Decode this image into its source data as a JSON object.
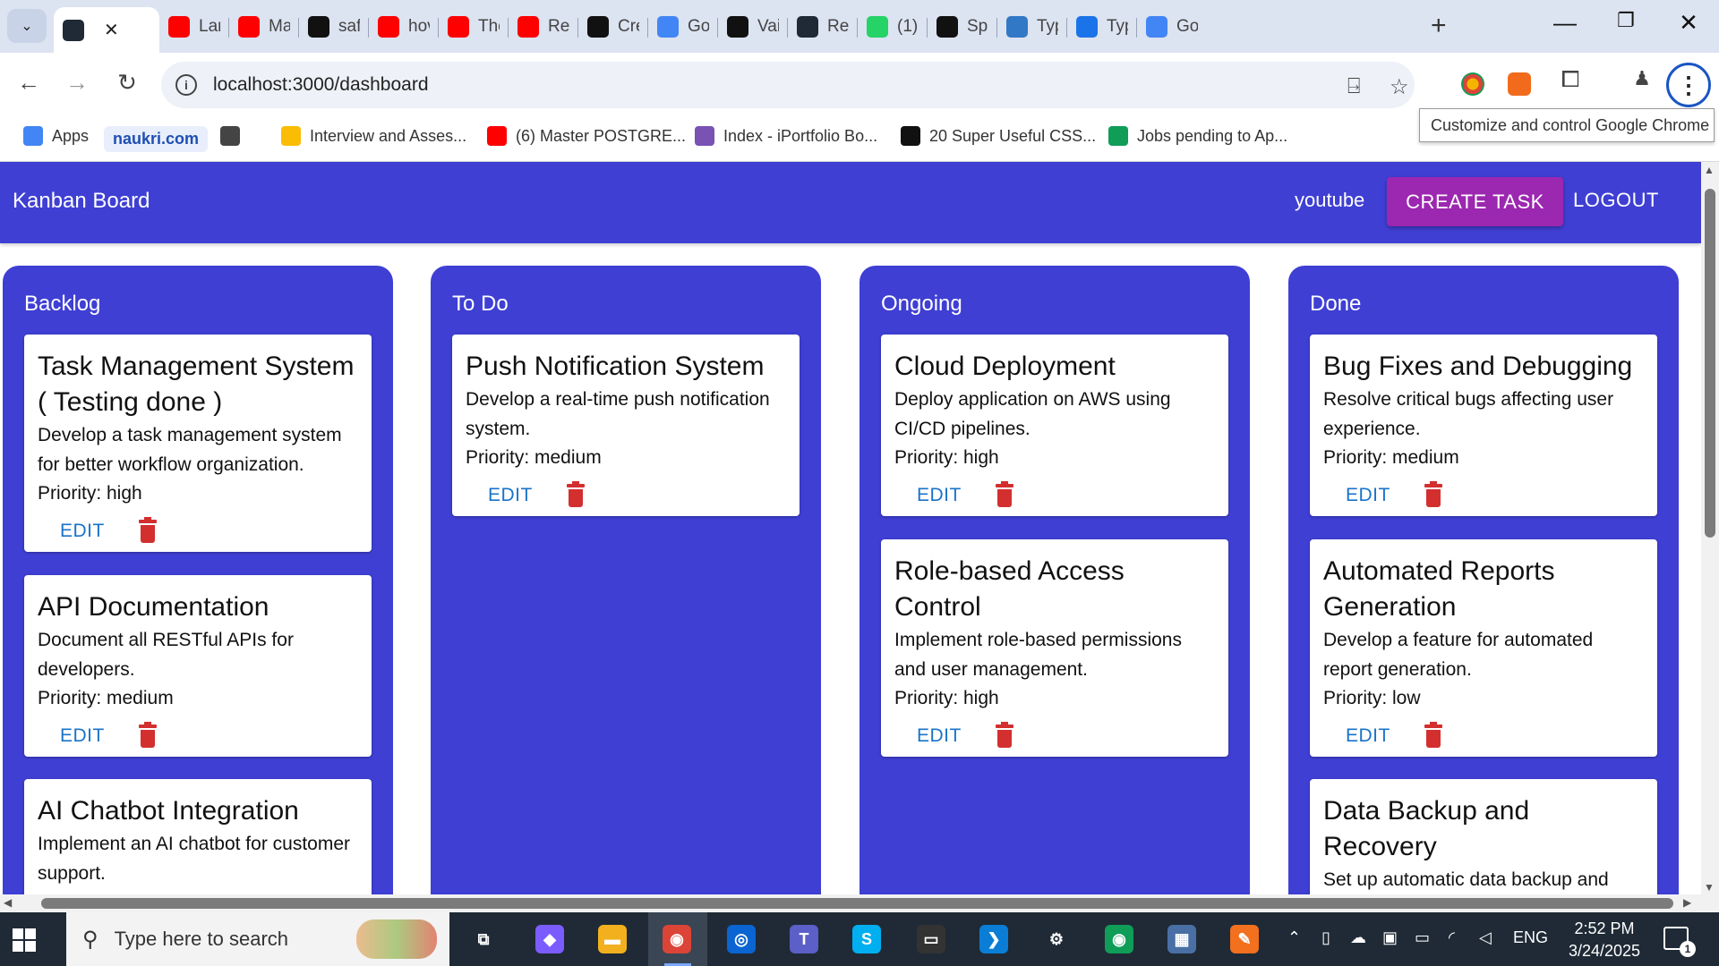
{
  "browser": {
    "tabs": [
      {
        "label": "",
        "icon": "react-icon",
        "color": "#1f2a36",
        "active": true
      },
      {
        "label": "Lar",
        "icon": "youtube-icon",
        "color": "#ff0000"
      },
      {
        "label": "Ma",
        "icon": "youtube-icon",
        "color": "#ff0000"
      },
      {
        "label": "safe",
        "icon": "github-icon",
        "color": "#111111"
      },
      {
        "label": "hov",
        "icon": "youtube-icon",
        "color": "#ff0000"
      },
      {
        "label": "The",
        "icon": "youtube-icon",
        "color": "#ff0000"
      },
      {
        "label": "Rea",
        "icon": "youtube-icon",
        "color": "#ff0000"
      },
      {
        "label": "Cre",
        "icon": "openai-icon",
        "color": "#111111"
      },
      {
        "label": "Goo",
        "icon": "google-icon",
        "color": "#4285f4"
      },
      {
        "label": "Vai",
        "icon": "github-icon",
        "color": "#111111"
      },
      {
        "label": "Rea",
        "icon": "react-icon",
        "color": "#1f2a36"
      },
      {
        "label": "(1)",
        "icon": "whatsapp-icon",
        "color": "#25d366"
      },
      {
        "label": "Spe",
        "icon": "medium-icon",
        "color": "#111111"
      },
      {
        "label": "Typ",
        "icon": "typescript-icon",
        "color": "#3178c6"
      },
      {
        "label": "Typ",
        "icon": "bolt-icon",
        "color": "#1a73e8"
      },
      {
        "label": "Goo",
        "icon": "google-keys-icon",
        "color": "#4285f4"
      }
    ],
    "url": "localhost:3000/dashboard",
    "tooltip": "Customize and control Google Chrome",
    "bookmarks": [
      {
        "label": "Apps",
        "icon": "apps-grid-icon",
        "color": "#4285f4"
      },
      {
        "label": "naukri.com",
        "icon": "",
        "color": "#1e4fb3",
        "pill": true
      },
      {
        "label": "",
        "icon": "grid-icon",
        "color": "#444444"
      },
      {
        "label": "Interview and Asses...",
        "icon": "google-drive-icon",
        "color": "#fbbc04"
      },
      {
        "label": "(6) Master POSTGRE...",
        "icon": "youtube-icon",
        "color": "#ff0000"
      },
      {
        "label": "Index - iPortfolio Bo...",
        "icon": "bootstrap-icon",
        "color": "#7952b3"
      },
      {
        "label": "20 Super Useful CSS...",
        "icon": "dev-icon",
        "color": "#111111"
      },
      {
        "label": "Jobs pending to Ap...",
        "icon": "sheets-icon",
        "color": "#0f9d58"
      }
    ]
  },
  "app": {
    "title": "Kanban Board",
    "user": "youtube",
    "create_label": "CREATE TASK",
    "logout_label": "LOGOUT",
    "accent": "#3f3fd4",
    "create_color": "#9c27b0",
    "edit_label": "EDIT",
    "columns": [
      {
        "title": "Backlog",
        "cards": [
          {
            "title": "Task Management System ( Testing done )",
            "description": "Develop a task management system for better workflow organization.",
            "priority": "Priority: high"
          },
          {
            "title": "API Documentation",
            "description": "Document all RESTful APIs for developers.",
            "priority": "Priority: medium"
          },
          {
            "title": "AI Chatbot Integration",
            "description": "Implement an AI chatbot for customer support.",
            "priority": ""
          }
        ]
      },
      {
        "title": "To Do",
        "cards": [
          {
            "title": "Push Notification System",
            "description": "Develop a real-time push notification system.",
            "priority": "Priority: medium"
          }
        ]
      },
      {
        "title": "Ongoing",
        "cards": [
          {
            "title": "Cloud Deployment",
            "description": "Deploy application on AWS using CI/CD pipelines.",
            "priority": "Priority: high"
          },
          {
            "title": "Role-based Access Control",
            "description": "Implement role-based permissions and user management.",
            "priority": "Priority: high"
          }
        ]
      },
      {
        "title": "Done",
        "cards": [
          {
            "title": "Bug Fixes and Debugging",
            "description": "Resolve critical bugs affecting user experience.",
            "priority": "Priority: medium"
          },
          {
            "title": "Automated Reports Generation",
            "description": "Develop a feature for automated report generation.",
            "priority": "Priority: low"
          },
          {
            "title": "Data Backup and Recovery",
            "description": "Set up automatic data backup and",
            "priority": ""
          }
        ]
      }
    ]
  },
  "taskbar": {
    "search_placeholder": "Type here to search",
    "apps": [
      {
        "name": "task-view-icon",
        "color": "#1f2a36",
        "glyph": "⧉"
      },
      {
        "name": "copilot-icon",
        "color": "#7b5cff",
        "glyph": "◆"
      },
      {
        "name": "file-explorer-icon",
        "color": "#f2b01e",
        "glyph": "▬"
      },
      {
        "name": "chrome-icon",
        "color": "#db4437",
        "glyph": "◉"
      },
      {
        "name": "outlook-icon",
        "color": "#0a64d2",
        "glyph": "◎"
      },
      {
        "name": "teams-icon",
        "color": "#5b5fc7",
        "glyph": "T"
      },
      {
        "name": "skype-icon",
        "color": "#00aff0",
        "glyph": "S"
      },
      {
        "name": "terminal-icon",
        "color": "#333333",
        "glyph": "▭"
      },
      {
        "name": "vscode-icon",
        "color": "#0a7ed6",
        "glyph": "❯"
      },
      {
        "name": "settings-icon",
        "color": "#1f2a36",
        "glyph": "⚙"
      },
      {
        "name": "chrome-icon",
        "color": "#0f9d58",
        "glyph": "◉"
      },
      {
        "name": "calculator-icon",
        "color": "#4a6fa5",
        "glyph": "▦"
      },
      {
        "name": "pen-icon",
        "color": "#f2701e",
        "glyph": "✎"
      }
    ],
    "language": "ENG",
    "time": "2:52 PM",
    "date": "3/24/2025",
    "notifications": "1"
  }
}
